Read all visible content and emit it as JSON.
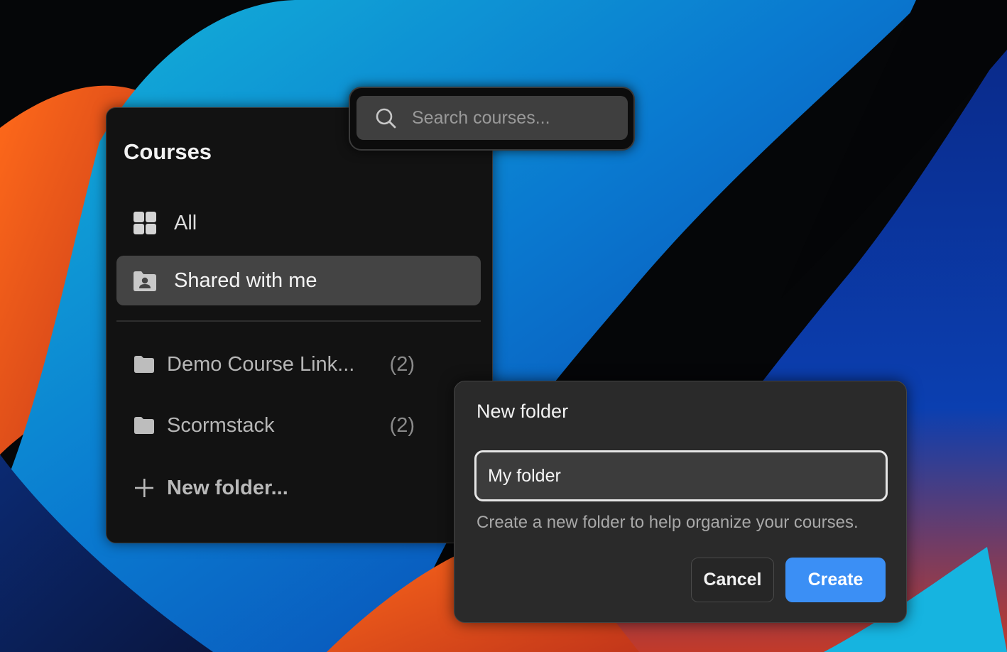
{
  "search": {
    "placeholder": "Search courses...",
    "value": ""
  },
  "sidebar": {
    "title": "Courses",
    "items": [
      {
        "label": "All",
        "icon": "grid-icon",
        "active": false
      },
      {
        "label": "Shared with me",
        "icon": "shared-folder-icon",
        "active": true
      }
    ],
    "folders": [
      {
        "label": "Demo Course Link...",
        "count": "(2)",
        "icon": "folder-icon"
      },
      {
        "label": "Scormstack",
        "count": "(2)",
        "icon": "folder-icon"
      }
    ],
    "new_folder_label": "New folder..."
  },
  "dialog": {
    "title": "New folder",
    "input_value": "My folder",
    "help_text": "Create a new folder to help organize your courses.",
    "cancel_label": "Cancel",
    "create_label": "Create"
  },
  "colors": {
    "accent": "#3b8ff5",
    "panel": "#121212",
    "dialog": "#2a2a2a",
    "active_item": "#444444"
  }
}
